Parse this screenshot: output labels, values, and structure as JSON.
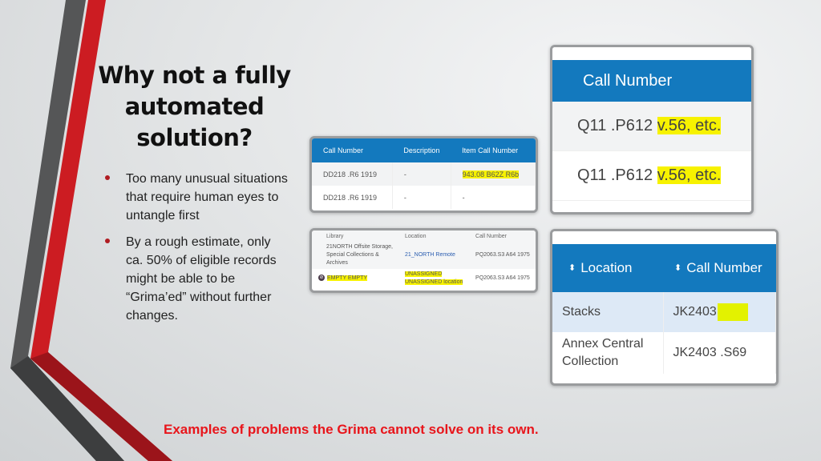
{
  "slide": {
    "title": "Why not a fully automated solution?",
    "bullets": [
      "Too many unusual situations that require human eyes to untangle first",
      "By a rough estimate, only ca. 50% of eligible records might be able to be “Grima’ed” without further changes."
    ],
    "caption": "Examples of problems the Grima cannot solve on its own.",
    "colors": {
      "accent_red": "#e8151b",
      "bullet_red": "#b01c22",
      "header_blue": "#1379be",
      "highlight": "#f7f200"
    }
  },
  "screenshot1": {
    "headers": [
      "Call Number",
      "Description",
      "Item Call Number"
    ],
    "rows": [
      [
        "DD218 .R6 1919",
        "-",
        "943.08 B62Z R6b"
      ],
      [
        "DD218 .R6 1919",
        "-",
        "-"
      ]
    ]
  },
  "screenshot2": {
    "headers": [
      "Library",
      "Location",
      "Call Number"
    ],
    "rows": [
      {
        "library": "21NORTH Offsite Storage, Special Collections & Archives",
        "location": "21_NORTH Remote",
        "location2": "",
        "call_number": "PQ2063.S3 A64 1975"
      },
      {
        "library": "EMPTY EMPTY",
        "location": "UNASSIGNED",
        "location2": "UNASSIGNED location",
        "call_number": "PQ2063.S3 A64 1975"
      }
    ]
  },
  "screenshot3": {
    "header": "Call Number",
    "rows": [
      {
        "base": "Q11 .P612",
        "highlighted": "v.56, etc."
      },
      {
        "base": "Q11 .P612",
        "highlighted": "v.56, etc."
      }
    ]
  },
  "screenshot4": {
    "headers": [
      "Location",
      "Call Number"
    ],
    "rows": [
      [
        "Stacks",
        "JK2403"
      ],
      [
        "Annex Central Collection",
        "JK2403 .S69"
      ]
    ]
  }
}
